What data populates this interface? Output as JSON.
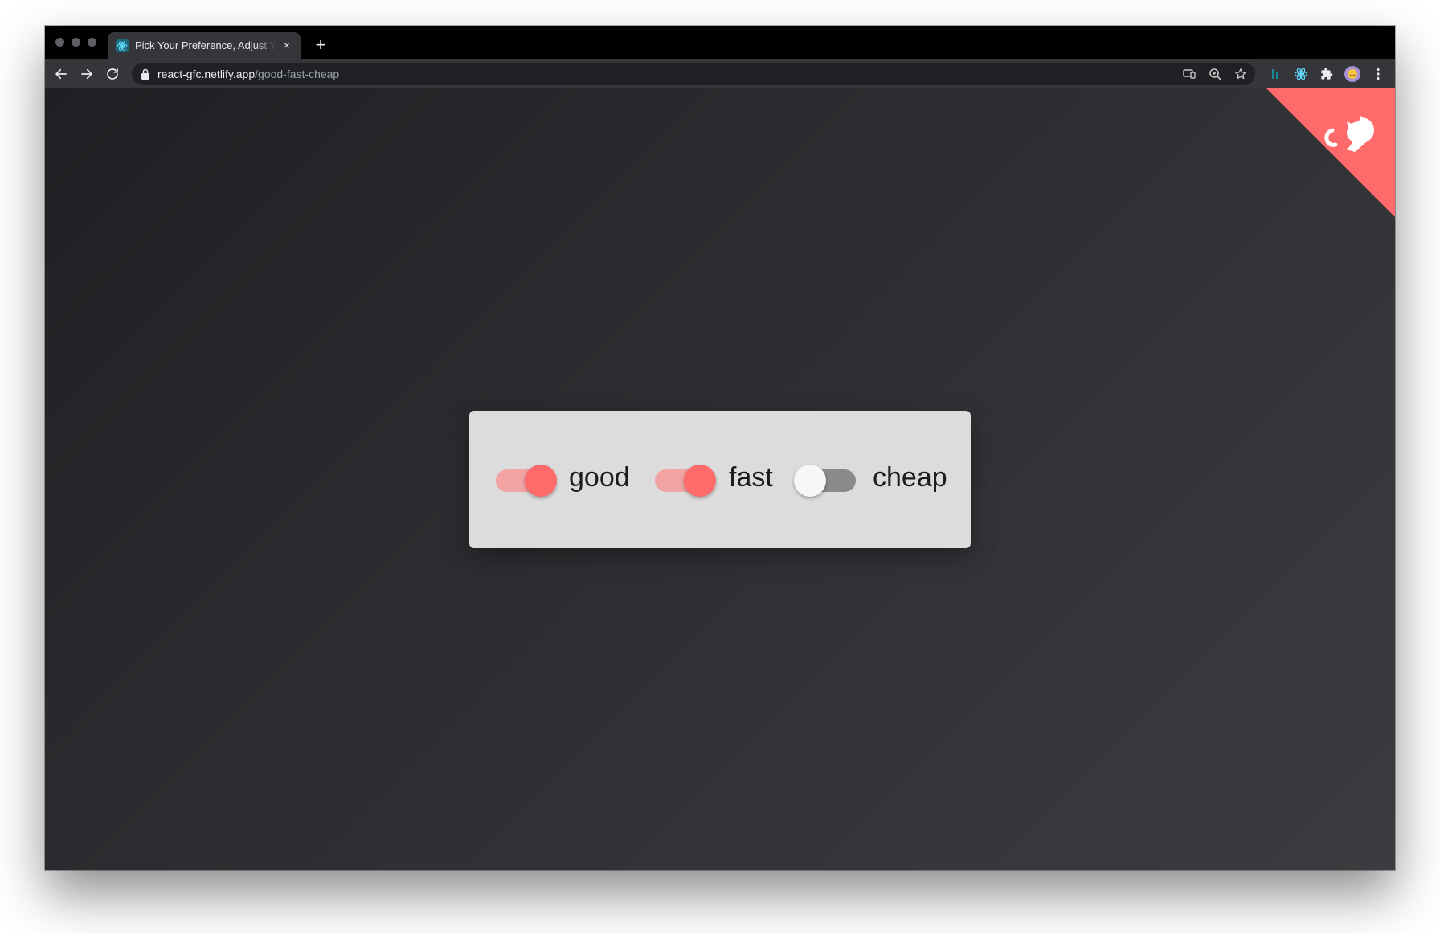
{
  "browser": {
    "tab_title": "Pick Your Preference, Adjust Your Expectations",
    "tab_close": "×",
    "new_tab": "+",
    "url_host": "react-gfc.netlify.app",
    "url_path": "/good-fast-cheap"
  },
  "page": {
    "corner_color": "#ff6b6b",
    "toggles": [
      {
        "label": "good",
        "on": true
      },
      {
        "label": "fast",
        "on": true
      },
      {
        "label": "cheap",
        "on": false
      }
    ]
  },
  "colors": {
    "accent": "#ff6b6b",
    "track_on": "#f2a3a3",
    "track_off": "#8a8a8a",
    "thumb_off": "#f7f7f7"
  }
}
